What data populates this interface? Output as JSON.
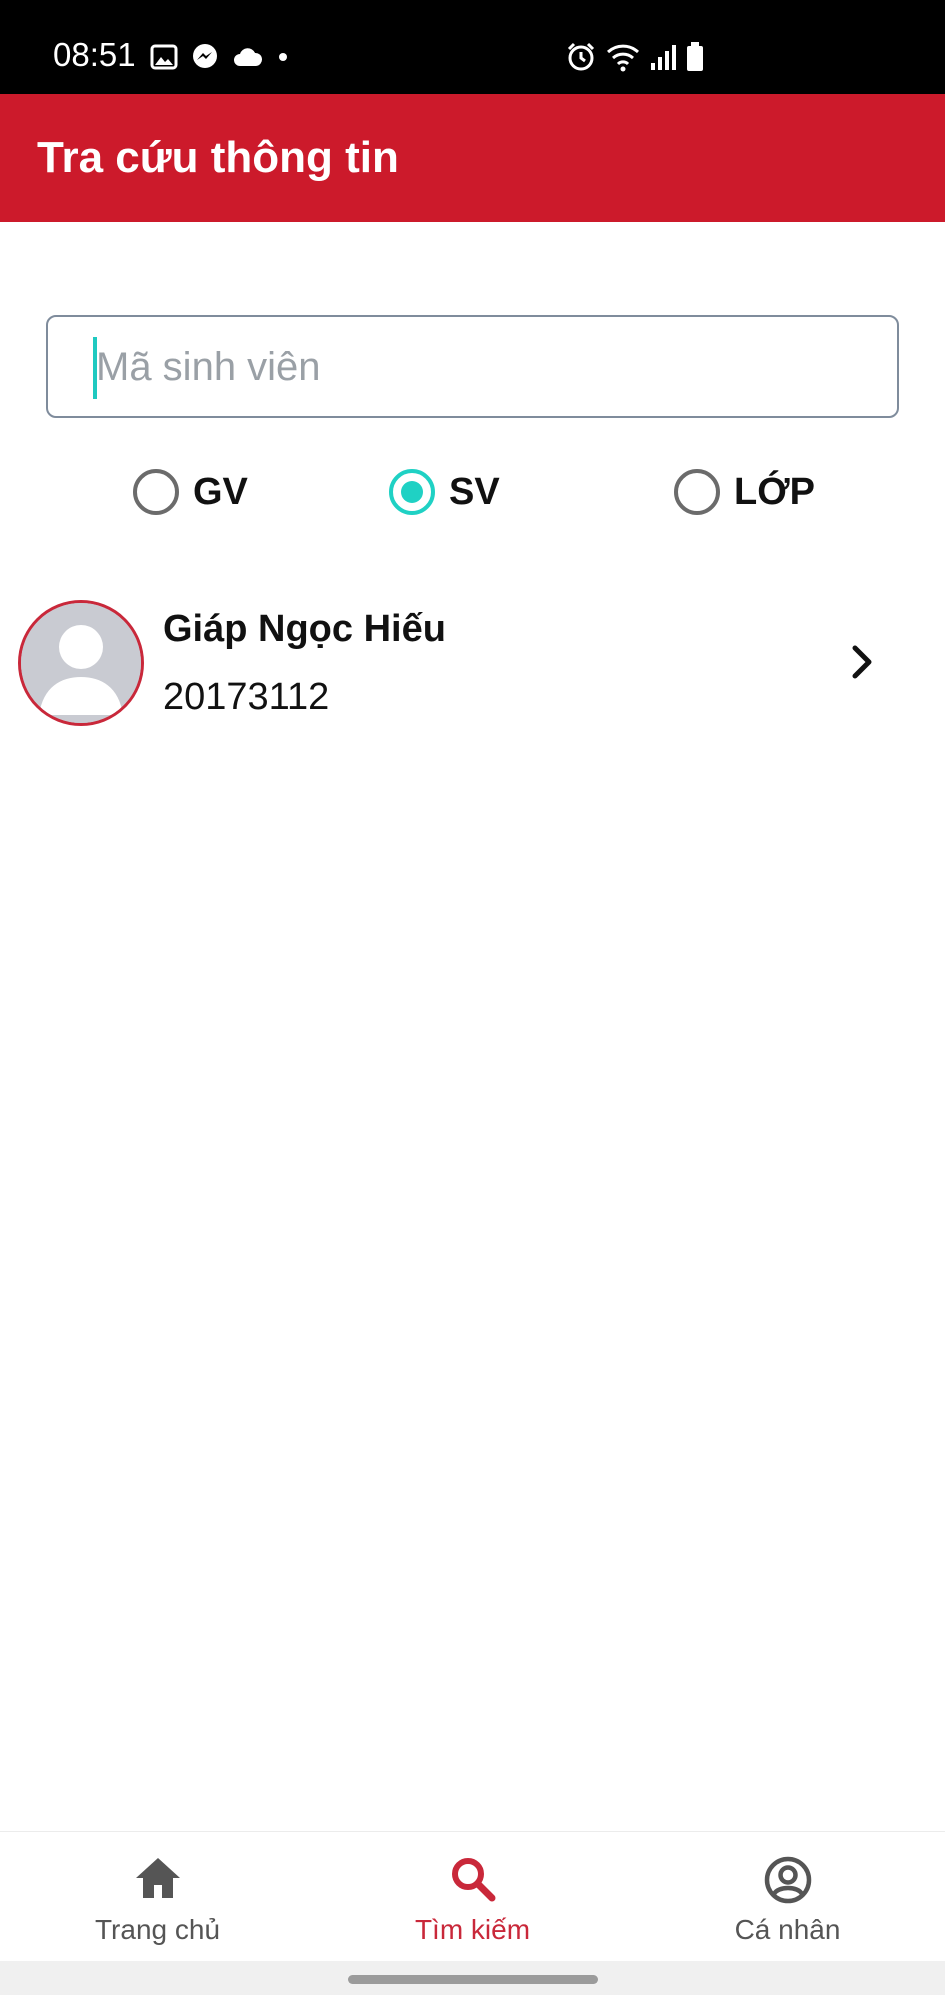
{
  "status_bar": {
    "time": "08:51",
    "left_icons": [
      "image-icon",
      "messenger-icon",
      "cloud-icon",
      "dot-icon"
    ],
    "right_icons": [
      "alarm-icon",
      "wifi-icon",
      "signal-icon",
      "battery-icon"
    ]
  },
  "header": {
    "title": "Tra cứu thông tin",
    "background": "#cc1a2b"
  },
  "search": {
    "placeholder": "Mã sinh viên",
    "value": ""
  },
  "filters": {
    "options": [
      {
        "label": "GV",
        "checked": false
      },
      {
        "label": "SV",
        "checked": true
      },
      {
        "label": "LỚP",
        "checked": false
      }
    ],
    "accent": "#1fd1c4"
  },
  "results": [
    {
      "name": "Giáp Ngọc Hiếu",
      "id": "20173112",
      "icon": "avatar-placeholder-icon"
    }
  ],
  "bottom_nav": {
    "items": [
      {
        "label": "Trang chủ",
        "icon": "home-icon",
        "active": false
      },
      {
        "label": "Tìm kiếm",
        "icon": "search-icon",
        "active": true
      },
      {
        "label": "Cá nhân",
        "icon": "account-circle-icon",
        "active": false
      }
    ],
    "active_color": "#c9283a"
  }
}
